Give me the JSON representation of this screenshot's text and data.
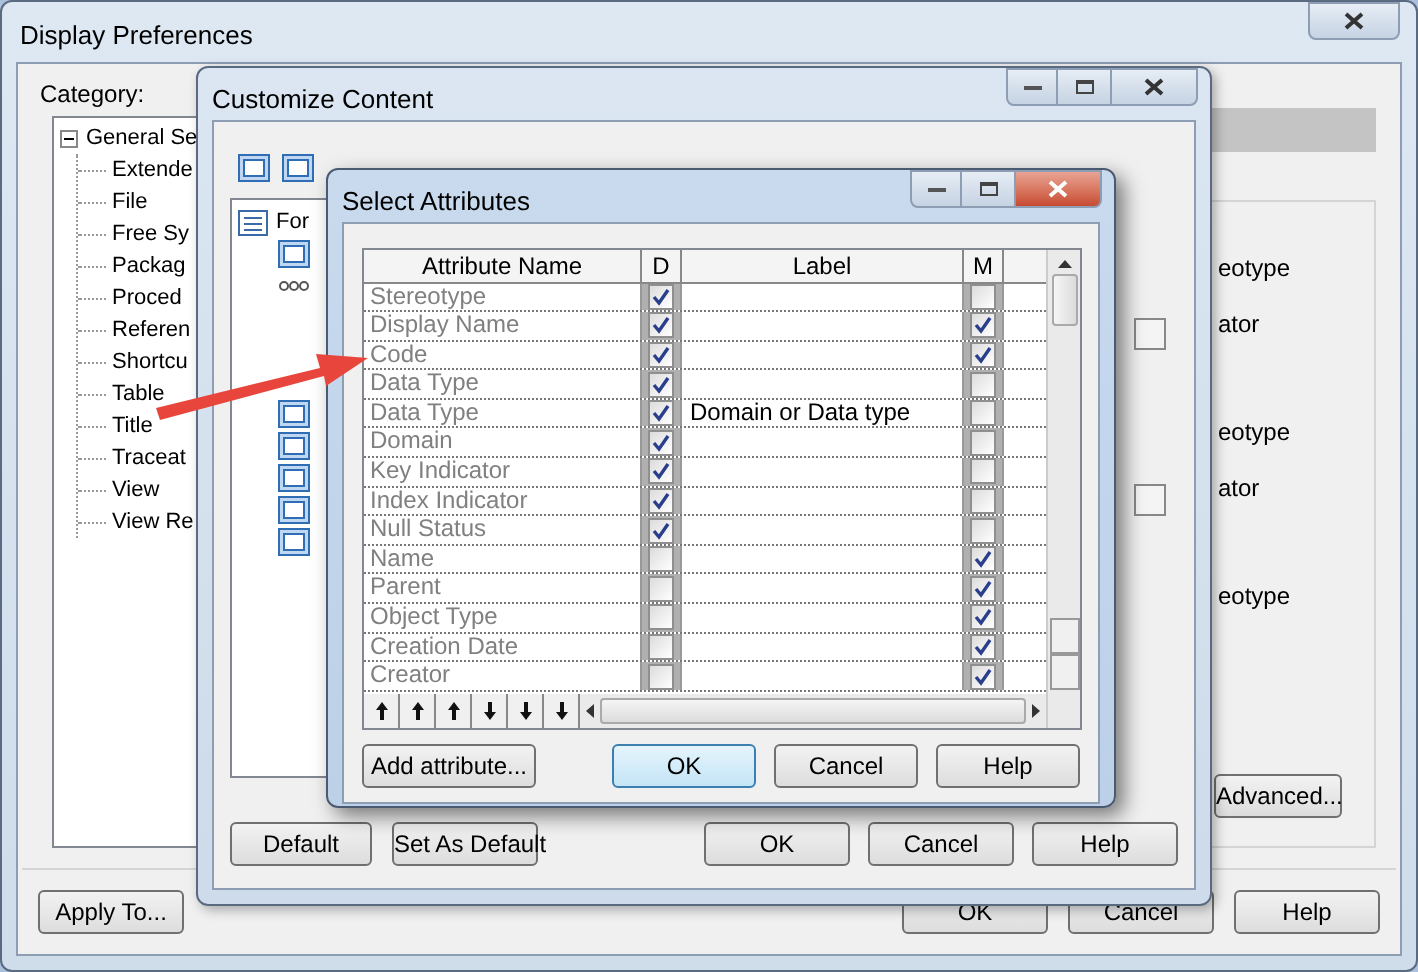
{
  "display_preferences": {
    "title": "Display Preferences",
    "category_label": "Category:",
    "tree": {
      "label": "General Se",
      "expanded": true,
      "children": [
        {
          "label": "Extende"
        },
        {
          "label": "File"
        },
        {
          "label": "Free Sy"
        },
        {
          "label": "Packag"
        },
        {
          "label": "Proced"
        },
        {
          "label": "Referen"
        },
        {
          "label": "Shortcu"
        },
        {
          "label": "Table"
        },
        {
          "label": "Title"
        },
        {
          "label": "Traceat"
        },
        {
          "label": "View"
        },
        {
          "label": "View Re"
        }
      ]
    },
    "side_labels": [
      "eotype",
      "ator",
      "eotype",
      "ator",
      "eotype"
    ],
    "advanced_button": "Advanced...",
    "apply_button": "Apply To...",
    "buttons": [
      "OK",
      "Cancel",
      "Help"
    ]
  },
  "customize_content": {
    "title": "Customize Content",
    "tree": [
      {
        "label": "For",
        "children": [
          {
            "kind": "table"
          },
          {
            "kind": "dots"
          },
          {
            "kind": "table"
          },
          {
            "kind": "table"
          },
          {
            "kind": "table"
          },
          {
            "kind": "table"
          },
          {
            "kind": "table"
          }
        ]
      }
    ],
    "left_buttons": [
      "Default",
      "Set As Default"
    ],
    "right_buttons": [
      "OK",
      "Cancel",
      "Help"
    ]
  },
  "select_attributes": {
    "title": "Select Attributes",
    "columns": [
      "Attribute Name",
      "D",
      "Label",
      "M"
    ],
    "rows": [
      {
        "name": "Stereotype",
        "d": true,
        "m": false
      },
      {
        "name": "Display Name",
        "d": true,
        "m": true
      },
      {
        "name": "Code",
        "d": true,
        "m": true
      },
      {
        "name": "Data Type",
        "d": true,
        "m": false
      },
      {
        "name": "Data Type",
        "d": true,
        "label": "Domain or Data type",
        "m": false
      },
      {
        "name": "Domain",
        "d": true,
        "m": false
      },
      {
        "name": "Key Indicator",
        "d": true,
        "m": false
      },
      {
        "name": "Index Indicator",
        "d": true,
        "m": false
      },
      {
        "name": "Null Status",
        "d": true,
        "m": false
      },
      {
        "name": "Name",
        "d": false,
        "m": true
      },
      {
        "name": "Parent",
        "d": false,
        "m": true
      },
      {
        "name": "Object Type",
        "d": false,
        "m": true
      },
      {
        "name": "Creation Date",
        "d": false,
        "m": true
      },
      {
        "name": "Creator",
        "d": false,
        "m": true
      }
    ],
    "buttons": [
      {
        "label": "Add attribute...",
        "default": false
      },
      {
        "label": "OK",
        "default": true
      },
      {
        "label": "Cancel",
        "default": false
      },
      {
        "label": "Help",
        "default": false
      }
    ]
  }
}
